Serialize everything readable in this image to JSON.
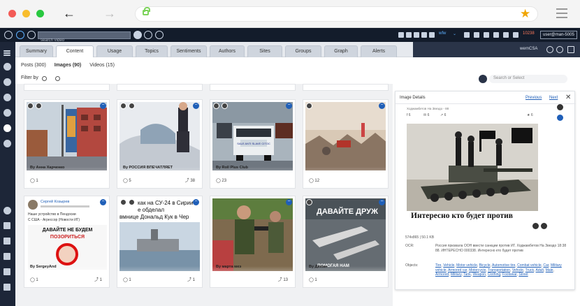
{
  "browser": {
    "traffic_lights": [
      "#f35b57",
      "#f8bd2d",
      "#28c840"
    ],
    "back_arrow": "←",
    "forward_arrow": "→",
    "star": "★"
  },
  "appbar": {
    "search_placeholder": "search video",
    "pill_text": "wfw",
    "alert_count": "10238",
    "user": "user@man-5005"
  },
  "tabs": [
    {
      "label": "Summary"
    },
    {
      "label": "Content",
      "active": true
    },
    {
      "label": "Usage"
    },
    {
      "label": "Topics"
    },
    {
      "label": "Sentiments"
    },
    {
      "label": "Authors"
    },
    {
      "label": "Sites"
    },
    {
      "label": "Groups"
    },
    {
      "label": "Graph"
    },
    {
      "label": "Alerts"
    }
  ],
  "tab_panel_title": "wernCSA",
  "subtabs": {
    "posts": "Posts (300)",
    "images": "Images (90)",
    "videos": "Videos (15)"
  },
  "filter_label": "Filter by",
  "search_or_select": "Search or Select",
  "cards": [
    {
      "author": "By Анна Харченко",
      "comments": "1",
      "shares": ""
    },
    {
      "author": "By РОССИЯ ВПЕЧАТЛЯЕТ",
      "comments": "5",
      "shares": "38"
    },
    {
      "author": "By Roll Plus Club",
      "comments": "23",
      "shares": ""
    },
    {
      "author": "",
      "comments": "12",
      "shares": ""
    },
    {
      "author": "By SergeyAnd",
      "comments": "1",
      "shares": "1"
    },
    {
      "author": "",
      "comments": "1",
      "shares": "1"
    },
    {
      "author": "By марта меэ",
      "comments": "",
      "shares": "13"
    },
    {
      "author": "By Диман",
      "comments": "1",
      "shares": ""
    }
  ],
  "card_texts": {
    "truck_sign": "SALE ANTI SLAVE CITOC",
    "post_user": "Сергей Козырев",
    "post_line1": "Наше устройство в Пендосии",
    "post_line2": "С США - Агрессор (Новости ИГ)",
    "meme_top": "ДАВАЙТЕ НЕ БУДЕМ",
    "meme_bottom": "ПОЗОРИТЬСЯ",
    "su24_line1": "как на СУ-24 в Сирии",
    "su24_line2": "е обделал",
    "su24_line3": "вмнице Дональд Кук в Чер",
    "dr_text": "ДАВАЙТЕ ДРУЖ",
    "dr_sub": "ПОМОГАЯ НАМ"
  },
  "details": {
    "title": "Image Details",
    "previous": "Previous",
    "next": "Next",
    "close": "✕",
    "meta_line": "Ходжамбетов На Звездо - 88",
    "stats": [
      "6",
      "6",
      "6"
    ],
    "rating": "6",
    "caption": "Интересно кто будет против",
    "file_info": "574x865 | 50.1 KB",
    "ocr_label": "OCR:",
    "ocr_text": "Россия призвала ООН ввести санкции против ИГ. Ходжамбетов На Звездо 18:38 88. ИНТЕРЕСНО 000338. Интересно кто будет против",
    "objects_label": "Objects:",
    "objects": [
      "Tire",
      "Vehicle",
      "Motor vehicle",
      "Bicycle",
      "Automotive tire",
      "Combat vehicle",
      "Car",
      "Military vehicle",
      "Armored car",
      "Motorcycle",
      "Transportation",
      "Vehicle",
      "Truck",
      "Adult",
      "Male",
      "Armored",
      "Military",
      "Tank",
      "Weapon",
      "Clothing",
      "Footwear",
      "Street"
    ]
  }
}
